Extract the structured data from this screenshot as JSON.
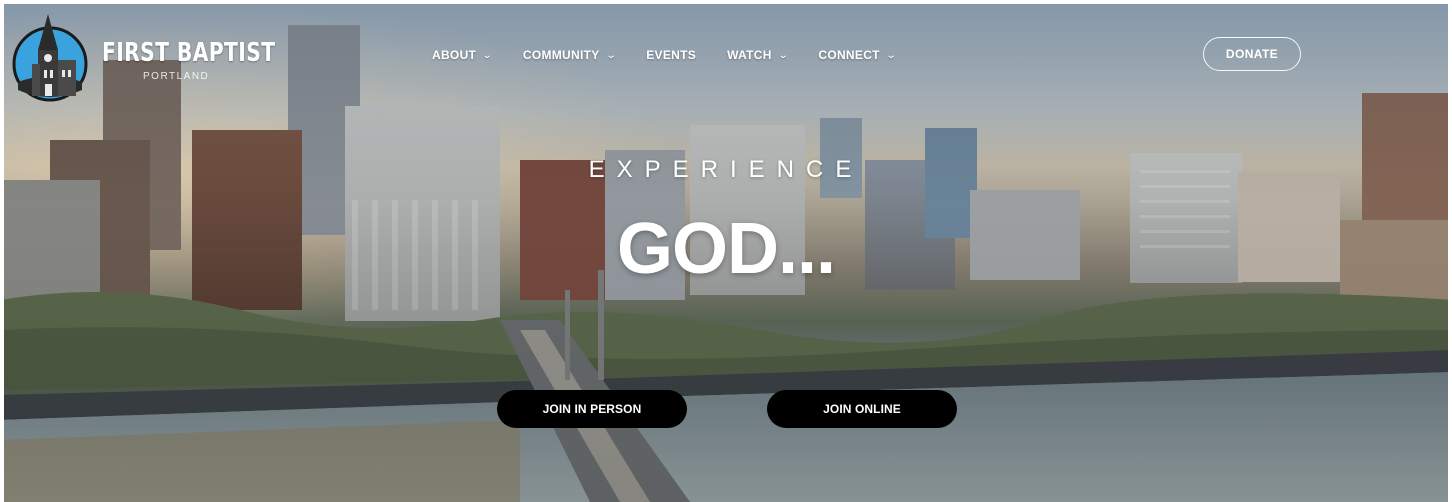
{
  "header": {
    "brand_name": "FIRST BAPTIST",
    "brand_sub": "PORTLAND",
    "nav": [
      {
        "label": "ABOUT",
        "has_dropdown": true
      },
      {
        "label": "COMMUNITY",
        "has_dropdown": true
      },
      {
        "label": "EVENTS",
        "has_dropdown": false
      },
      {
        "label": "WATCH",
        "has_dropdown": true
      },
      {
        "label": "CONNECT",
        "has_dropdown": true
      }
    ],
    "chevron": "⌄",
    "donate_label": "DONATE"
  },
  "hero": {
    "kicker": "EXPERIENCE",
    "headline": "GOD...",
    "buttons": {
      "join_in_person": "JOIN IN PERSON",
      "join_online": "JOIN ONLINE"
    }
  },
  "icons": {
    "logo": "church-steeple-logo-icon",
    "dropdown": "chevron-down-icon"
  },
  "colors": {
    "nav_text": "#ffffff",
    "cta_bg": "#000000",
    "cta_text": "#ffffff",
    "logo_circle": "#3aa3dd"
  }
}
